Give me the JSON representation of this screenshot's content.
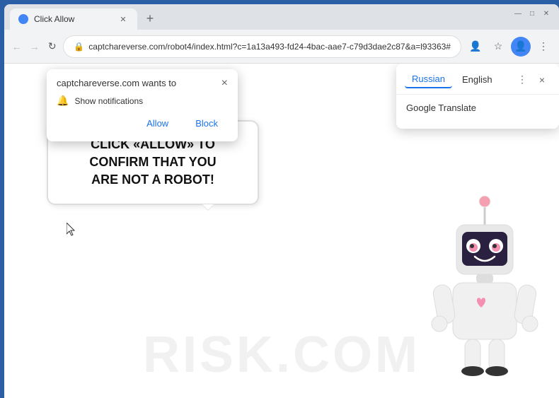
{
  "browser": {
    "tab": {
      "title": "Click Allow",
      "favicon": "●"
    },
    "url": "captchareverse.com/robot4/index.html?c=1a13a493-fd24-4bac-aae7-c79d3dae2c87&a=l93363#",
    "new_tab_label": "+"
  },
  "window_controls": {
    "minimize": "—",
    "maximize": "□",
    "close": "✕"
  },
  "notification": {
    "title": "captchareverse.com wants to",
    "description": "Show notifications",
    "allow_label": "Allow",
    "block_label": "Block",
    "close": "×"
  },
  "translate": {
    "tab_russian": "Russian",
    "tab_english": "English",
    "service": "Google Translate",
    "more_label": "⋮",
    "close_label": "×"
  },
  "page": {
    "speech_bubble_line1": "CLICK «ALLOW» TO CONFIRM THAT YOU",
    "speech_bubble_line2": "ARE NOT A ROBOT!",
    "watermark": "RISK.COM"
  }
}
